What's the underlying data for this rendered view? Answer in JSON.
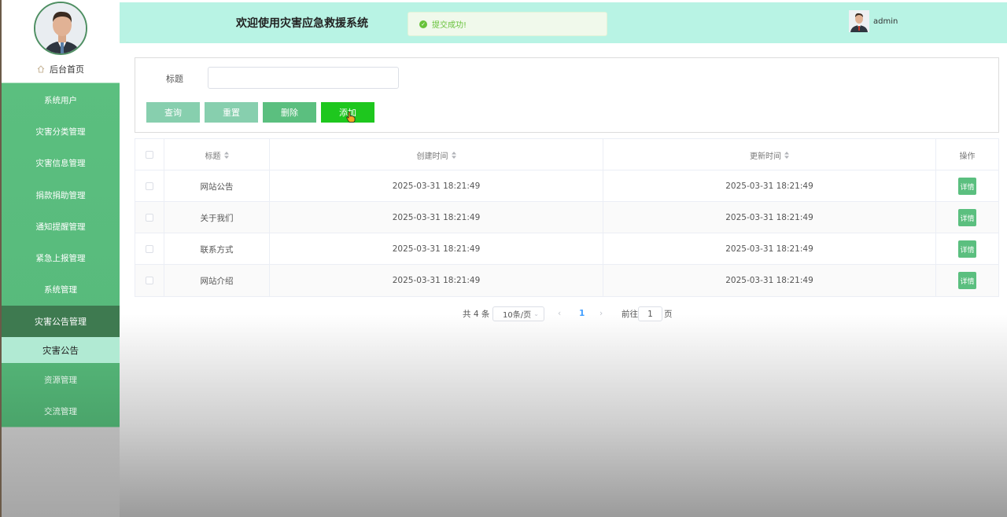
{
  "sidebar": {
    "home_label": "后台首页",
    "items": [
      {
        "label": "系统用户"
      },
      {
        "label": "灾害分类管理"
      },
      {
        "label": "灾害信息管理"
      },
      {
        "label": "捐款捐助管理"
      },
      {
        "label": "通知提醒管理"
      },
      {
        "label": "紧急上报管理"
      },
      {
        "label": "系统管理"
      },
      {
        "label": "灾害公告管理"
      },
      {
        "label": "资源管理"
      },
      {
        "label": "交流管理"
      }
    ],
    "sub_item": {
      "label": "灾害公告"
    }
  },
  "header": {
    "title": "欢迎使用灾害应急救援系统",
    "toast_text": "提交成功!",
    "username": "admin"
  },
  "search": {
    "label": "标题",
    "value": "",
    "buttons": {
      "query": "查询",
      "reset": "重置",
      "delete": "删除",
      "add": "添加"
    }
  },
  "table": {
    "headers": {
      "title": "标题",
      "created": "创建时间",
      "updated": "更新时间",
      "operation": "操作"
    },
    "rows": [
      {
        "title": "网站公告",
        "created": "2025-03-31 18:21:49",
        "updated": "2025-03-31 18:21:49",
        "action": "详情"
      },
      {
        "title": "关于我们",
        "created": "2025-03-31 18:21:49",
        "updated": "2025-03-31 18:21:49",
        "action": "详情"
      },
      {
        "title": "联系方式",
        "created": "2025-03-31 18:21:49",
        "updated": "2025-03-31 18:21:49",
        "action": "详情"
      },
      {
        "title": "网站介绍",
        "created": "2025-03-31 18:21:49",
        "updated": "2025-03-31 18:21:49",
        "action": "详情"
      }
    ]
  },
  "pagination": {
    "total": "共 4 条",
    "page_size": "10条/页",
    "current_page": "1",
    "goto_label": "前往",
    "goto_value": "1",
    "page_suffix": "页"
  },
  "colors": {
    "sidebar": "#5bbf7f",
    "header": "#b8f3e4",
    "active_nav": "#3e7a50",
    "add_button": "#1ec71e"
  }
}
